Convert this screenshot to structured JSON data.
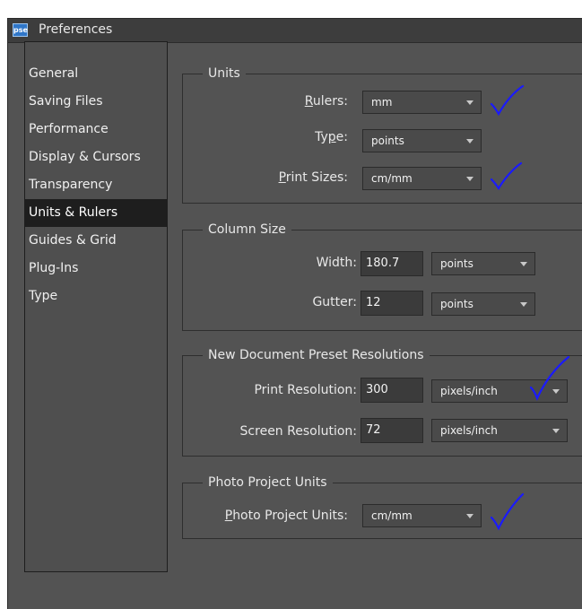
{
  "window": {
    "title": "Preferences",
    "app_icon_label": "pse"
  },
  "sidebar": {
    "items": [
      {
        "label": "General"
      },
      {
        "label": "Saving Files"
      },
      {
        "label": "Performance"
      },
      {
        "label": "Display & Cursors"
      },
      {
        "label": "Transparency"
      },
      {
        "label": "Units & Rulers",
        "selected": true
      },
      {
        "label": "Guides & Grid"
      },
      {
        "label": "Plug-Ins"
      },
      {
        "label": "Type"
      }
    ]
  },
  "units": {
    "title": "Units",
    "rulers": {
      "label_mnemonic": "R",
      "label_rest": "ulers:",
      "value": "mm"
    },
    "type": {
      "label_pre": "Ty",
      "label_mnemonic": "p",
      "label_post": "e:",
      "value": "points"
    },
    "print_sizes": {
      "label_mnemonic": "P",
      "label_rest": "rint Sizes:",
      "value": "cm/mm"
    }
  },
  "column_size": {
    "title": "Column Size",
    "width": {
      "label": "Width:",
      "value": "180.7",
      "unit": "points"
    },
    "gutter": {
      "label": "Gutter:",
      "value": "12",
      "unit": "points"
    }
  },
  "new_doc": {
    "title": "New Document Preset Resolutions",
    "print_resolution": {
      "label": "Print Resolution:",
      "value": "300",
      "unit": "pixels/inch"
    },
    "screen_resolution": {
      "label": "Screen Resolution:",
      "value": "72",
      "unit": "pixels/inch"
    }
  },
  "photo_project": {
    "title": "Photo Project Units",
    "units": {
      "label_mnemonic": "P",
      "label_rest": "hoto Project Units:",
      "value": "cm/mm"
    }
  },
  "colors": {
    "check_mark": "#1a1aff",
    "selected_bg": "#1e1e1e",
    "panel_bg": "#535353"
  }
}
